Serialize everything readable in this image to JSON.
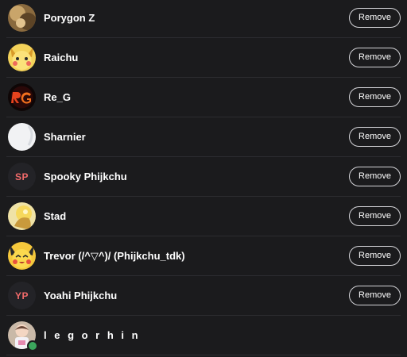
{
  "button_label": "Remove",
  "members": [
    {
      "name": "Porygon Z",
      "avatar": "image",
      "removable": true
    },
    {
      "name": "Raichu",
      "avatar": "image",
      "removable": true
    },
    {
      "name": "Re_G",
      "avatar": "image",
      "removable": true
    },
    {
      "name": "Sharnier",
      "avatar": "image",
      "removable": true
    },
    {
      "name": "Spooky Phijkchu",
      "avatar": "initials",
      "initials": "SP",
      "removable": true
    },
    {
      "name": "Stad",
      "avatar": "image",
      "removable": true
    },
    {
      "name": "Trevor (/^▽^)/ (Phijkchu_tdk)",
      "avatar": "image",
      "removable": true
    },
    {
      "name": "Yoahi Phijkchu",
      "avatar": "initials",
      "initials": "YP",
      "removable": true
    },
    {
      "name": "l e g o r h i n",
      "avatar": "image",
      "removable": false,
      "online": true
    }
  ],
  "colors": {
    "background": "#1b1b1d",
    "initials_text": "#f06a6a",
    "online": "#3ba55c"
  }
}
